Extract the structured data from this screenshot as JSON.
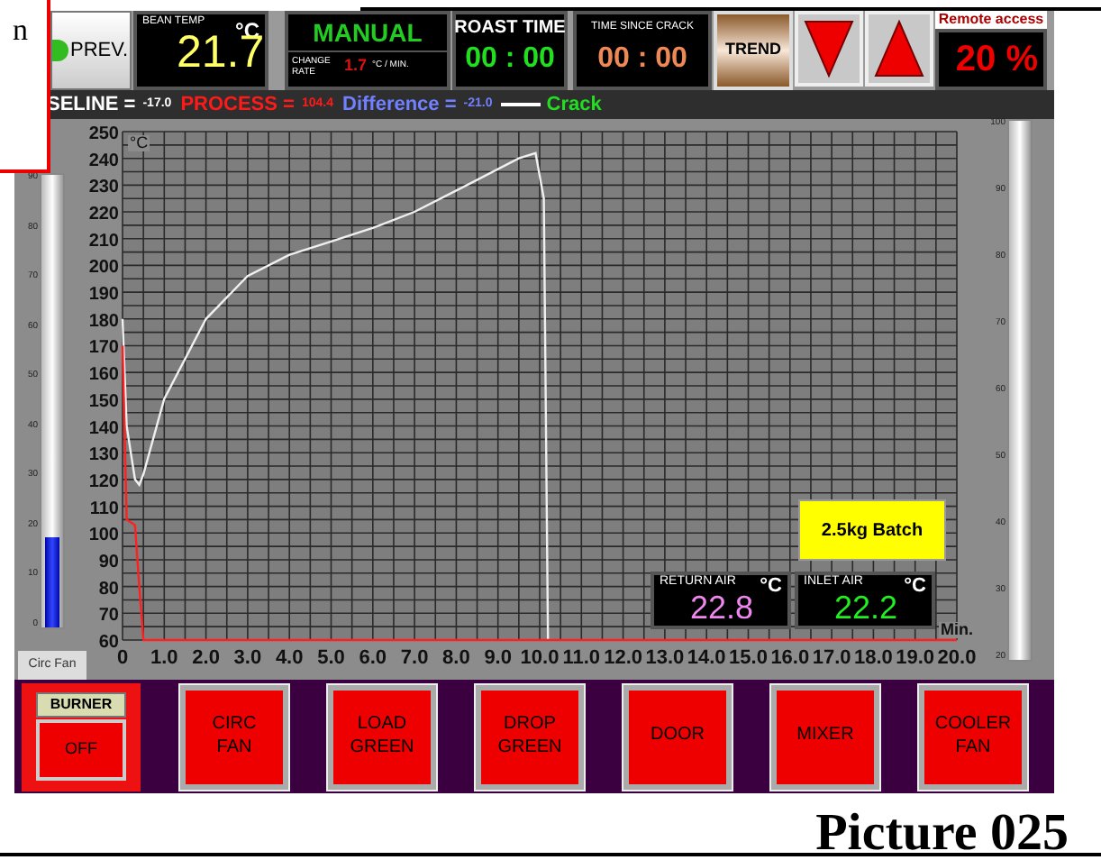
{
  "note": {
    "text": "n"
  },
  "prev_button": {
    "label": "PREV."
  },
  "bean_temp": {
    "label": "BEAN TEMP",
    "unit": "°C",
    "value": "21.7"
  },
  "mode": {
    "label": "MANUAL",
    "change_rate_label": "CHANGE RATE",
    "change_rate": "1.7",
    "change_rate_unit": "°C / MIN."
  },
  "roast_time": {
    "label": "ROAST TIME",
    "value": "00 : 00"
  },
  "time_since_crack": {
    "label": "TIME SINCE CRACK",
    "value": "00 : 00"
  },
  "trend_button": {
    "label": "TREND"
  },
  "arrow_buttons": [
    {
      "kind": "down"
    },
    {
      "kind": "up"
    }
  ],
  "remote_access": {
    "label": "Remote access",
    "value": "20 %"
  },
  "legend": [
    {
      "kind": "baseline",
      "label": "SELINE =",
      "value": "-17.0"
    },
    {
      "kind": "process",
      "label": "PROCESS =",
      "value": "104.4"
    },
    {
      "kind": "difference",
      "label": "Difference =",
      "value": "-21.0"
    },
    {
      "kind": "crack",
      "label": "Crack"
    }
  ],
  "left_gauge": {
    "label": "Circ Fan",
    "ticks": [
      "90",
      "80",
      "70",
      "60",
      "50",
      "40",
      "30",
      "20",
      "10",
      "0"
    ],
    "level": 0.2
  },
  "right_gauge": {
    "ticks": [
      "100",
      "90",
      "80",
      "70",
      "60",
      "50",
      "40",
      "30",
      "20"
    ]
  },
  "chart": {
    "y_unit": "°C",
    "x_unit": "Min.",
    "chart_data": {
      "type": "line",
      "x": [
        0,
        0.1,
        0.3,
        0.4,
        0.5,
        1,
        2,
        3,
        4,
        5,
        6,
        7,
        8,
        9,
        9.5,
        9.9,
        10.1,
        10.2,
        20
      ],
      "grid": true,
      "series": [
        {
          "color": "#f0f0f0",
          "values": [
            180,
            140,
            120,
            118,
            122,
            150,
            180,
            196,
            204,
            209,
            214,
            220,
            228,
            236,
            240,
            242,
            225,
            60,
            null
          ]
        },
        {
          "color": "#ff2020",
          "values": [
            170,
            105,
            103,
            80,
            60,
            60,
            60,
            60,
            60,
            60,
            60,
            60,
            60,
            60,
            60,
            60,
            60,
            60,
            60
          ]
        }
      ],
      "xlim": [
        0,
        20
      ],
      "ylim": [
        60,
        250
      ],
      "xticks": [
        {
          "value": 0,
          "label": "0"
        },
        {
          "value": 1,
          "label": "1.0"
        },
        {
          "value": 2,
          "label": "2.0"
        },
        {
          "value": 3,
          "label": "3.0"
        },
        {
          "value": 4,
          "label": "4.0"
        },
        {
          "value": 5,
          "label": "5.0"
        },
        {
          "value": 6,
          "label": "6.0"
        },
        {
          "value": 7,
          "label": "7.0"
        },
        {
          "value": 8,
          "label": "8.0"
        },
        {
          "value": 9,
          "label": "9.0"
        },
        {
          "value": 10,
          "label": "10.0"
        },
        {
          "value": 11,
          "label": "11.0"
        },
        {
          "value": 12,
          "label": "12.0"
        },
        {
          "value": 13,
          "label": "13.0"
        },
        {
          "value": 14,
          "label": "14.0"
        },
        {
          "value": 15,
          "label": "15.0"
        },
        {
          "value": 16,
          "label": "16.0"
        },
        {
          "value": 17,
          "label": "17.0"
        },
        {
          "value": 18,
          "label": "18.0"
        },
        {
          "value": 19,
          "label": "19.0"
        },
        {
          "value": 20,
          "label": "20.0"
        }
      ],
      "yticks": [
        60,
        70,
        80,
        90,
        100,
        110,
        120,
        130,
        140,
        150,
        160,
        170,
        180,
        190,
        200,
        210,
        220,
        230,
        240,
        250
      ]
    }
  },
  "batch_label": "2.5kg Batch",
  "air_readouts": [
    {
      "label": "RETURN AIR",
      "unit": "°C",
      "value": "22.8",
      "color": "#ee88ee"
    },
    {
      "label": "INLET AIR",
      "unit": "°C",
      "value": "22.2",
      "color": "#22ee22"
    }
  ],
  "burner": {
    "label": "BURNER",
    "button": "OFF"
  },
  "buttons": [
    "CIRC FAN",
    "LOAD GREEN",
    "DROP GREEN",
    "DOOR",
    "MIXER",
    "COOLER FAN"
  ],
  "caption": "Picture 025"
}
